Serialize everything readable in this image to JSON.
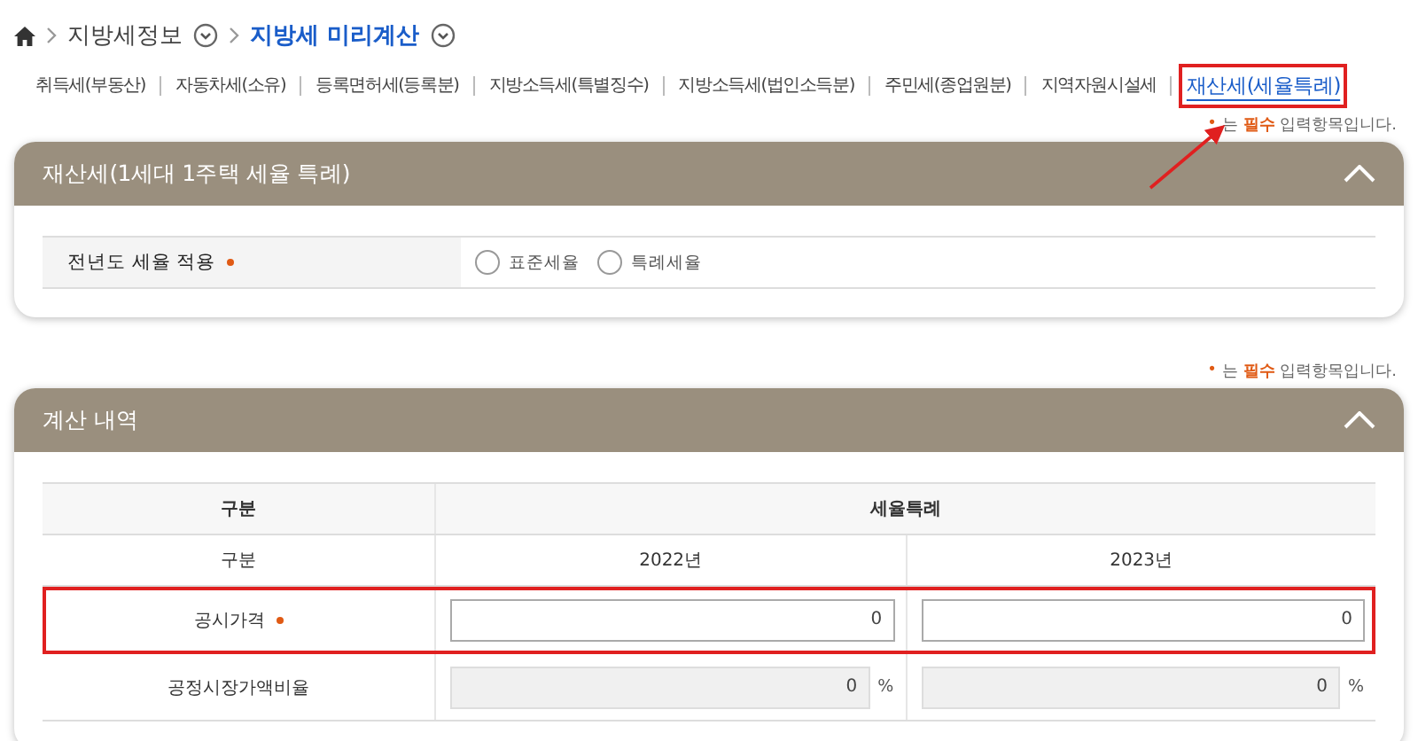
{
  "breadcrumb": [
    {
      "label": "지방세정보",
      "current": false
    },
    {
      "label": "지방세 미리계산",
      "current": true
    }
  ],
  "tabs": [
    {
      "label": "취득세(부동산)",
      "selected": false,
      "highlighted": false
    },
    {
      "label": "자동차세(소유)",
      "selected": false,
      "highlighted": false
    },
    {
      "label": "등록면허세(등록분)",
      "selected": false,
      "highlighted": false
    },
    {
      "label": "지방소득세(특별징수)",
      "selected": false,
      "highlighted": false
    },
    {
      "label": "지방소득세(법인소득분)",
      "selected": false,
      "highlighted": false
    },
    {
      "label": "주민세(종업원분)",
      "selected": false,
      "highlighted": false
    },
    {
      "label": "지역자원시설세",
      "selected": false,
      "highlighted": false
    },
    {
      "label": "재산세(세율특례)",
      "selected": true,
      "highlighted": true
    }
  ],
  "sections": [
    {
      "note": {
        "mark": "•",
        "text": "는 **필수** 입력항목입니다."
      },
      "title": "재산세(1세대 1주택 세율 특례)",
      "expanded": true,
      "kind": "radio",
      "field": {
        "label": "전년도 세율 적용",
        "required": true,
        "options": [
          {
            "label": "표준세율",
            "selected": false
          },
          {
            "label": "특례세율",
            "selected": false
          }
        ]
      }
    },
    {
      "note": {
        "mark": "•",
        "text": "는 **필수** 입력항목입니다."
      },
      "title": "계산 내역",
      "expanded": true,
      "kind": "table",
      "header": [
        "구분",
        "세율특례"
      ],
      "rows": [
        {
          "label": "구분",
          "required": false,
          "highlighted": false,
          "cells": [
            {
              "kind": "text",
              "text": "2022년"
            },
            {
              "kind": "text",
              "text": "2023년"
            }
          ]
        },
        {
          "label": "공시가격",
          "required": true,
          "highlighted": true,
          "cells": [
            {
              "kind": "input",
              "value": "0",
              "disabled": false
            },
            {
              "kind": "input",
              "value": "0",
              "disabled": false
            }
          ]
        },
        {
          "label": "공정시장가액비율",
          "required": false,
          "highlighted": false,
          "cells": [
            {
              "kind": "input",
              "value": "0",
              "disabled": true,
              "unit": "%"
            },
            {
              "kind": "input",
              "value": "0",
              "disabled": true,
              "unit": "%"
            }
          ]
        }
      ]
    }
  ],
  "annotation_arrow": true
}
